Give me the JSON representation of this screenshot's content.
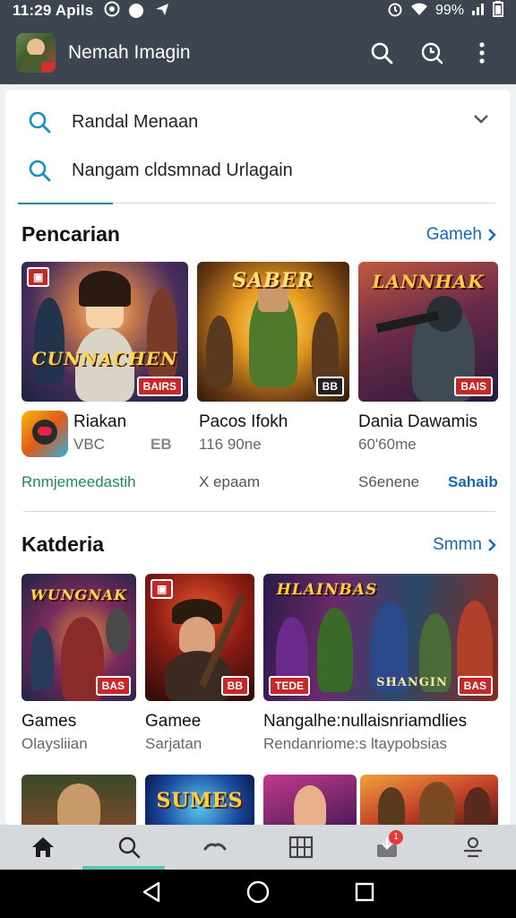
{
  "status_bar": {
    "time": "11:29 Apils",
    "battery_text": "99%"
  },
  "app_bar": {
    "title": "Nemah Imagin"
  },
  "search": {
    "row1_text": "Randal Menaan",
    "row2_text": "Nangam cldsmnad Urlagain"
  },
  "section1": {
    "title": "Pencarian",
    "link_label": "Gameh",
    "cards": [
      {
        "art_text": "CUNNACHEN",
        "tag": "BAIRS",
        "title": "Riakan",
        "sub": "VBC",
        "extra": "Rnmjemeedastih",
        "sub_badge": "EB"
      },
      {
        "art_text": "SABER",
        "tag": "BB",
        "title": "Pacos Ifokh",
        "sub": "116 90ne",
        "extra": "X epaam"
      },
      {
        "art_text": "LANNHAK",
        "tag": "BAIS",
        "title": "Dania Dawamis",
        "sub": "60'60me",
        "extra": "S6enene",
        "link": "Sahaib"
      }
    ]
  },
  "section2": {
    "title": "Katderia",
    "link_label": "Smmn",
    "cards": [
      {
        "art_text": "WUNGNAK",
        "tag": "BAS",
        "title": "Games",
        "sub": "Olaysliian"
      },
      {
        "art_text": "",
        "tag": "BB",
        "title": "Gamee",
        "sub": "Sarjatan"
      },
      {
        "art_text": "HLAINBAS",
        "tag": "BAS",
        "tag2": "TEDE",
        "bottom_text": "SHANGIN",
        "title": "Nangalhe:nullaisnriamdlies",
        "sub": "Rendanriome:s ltaypobsias"
      }
    ],
    "row3_art": [
      "",
      "SUMES",
      "",
      ""
    ]
  },
  "bottom_nav": {
    "notif_count": "1"
  },
  "colors": {
    "accent": "#1767b5",
    "teal": "#1a8a9a",
    "green_text": "#1e8a5a",
    "appbar": "#3d4650",
    "tag_red": "#c62828"
  }
}
